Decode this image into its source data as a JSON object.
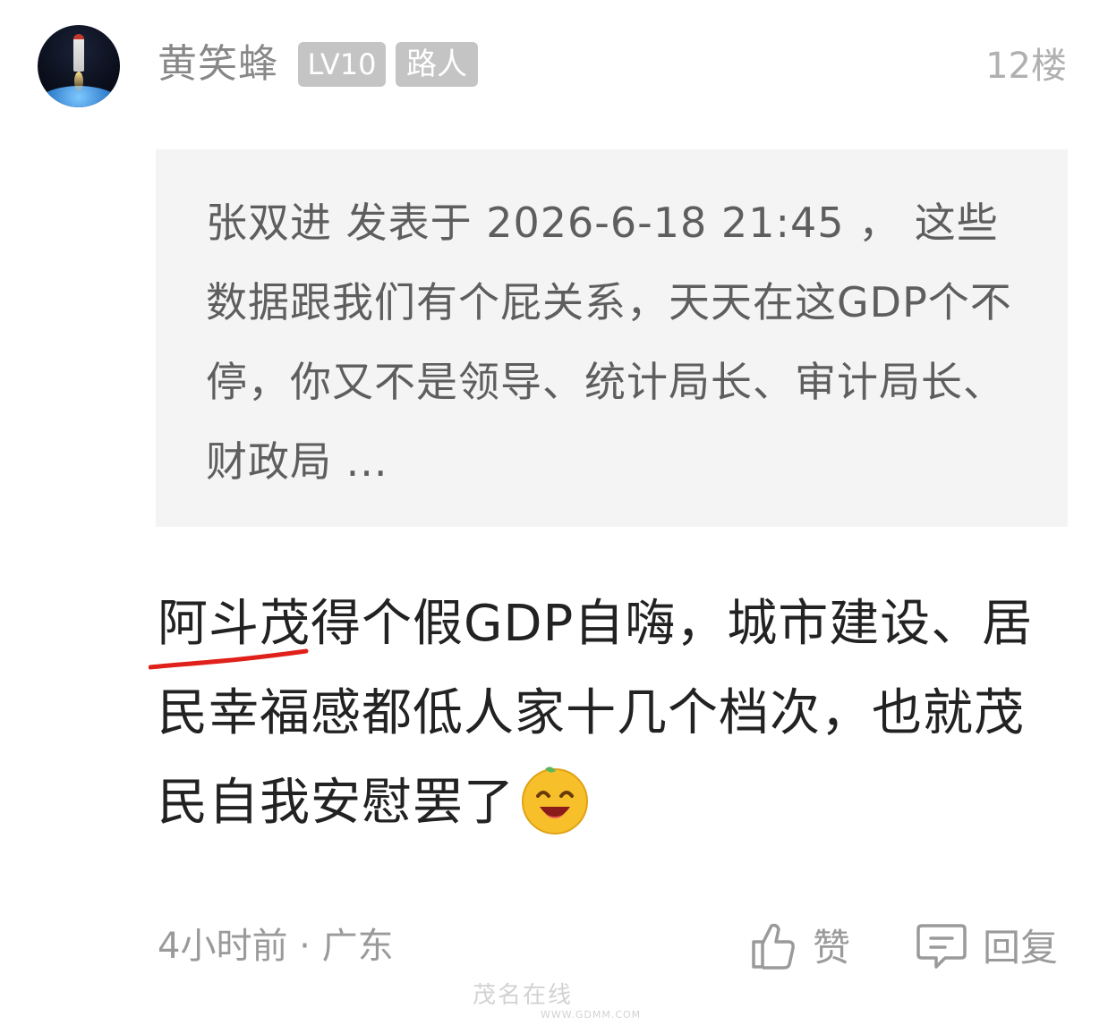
{
  "comment": {
    "author": {
      "name": "黄笑蜂",
      "level_badge": "LV10",
      "role_badge": "路人",
      "avatar_icon": "rocket-earth-avatar"
    },
    "floor": "12楼",
    "quote": {
      "text": "张双进 发表于 2026-6-18 21:45 ， 这些数据跟我们有个屁关系，天天在这GDP个不停，你又不是领导、统计局长、审计局长、财政局 ..."
    },
    "body": {
      "text": "阿斗茂得个假GDP自嗨，城市建设、居民幸福感都低人家十几个档次，也就茂民自我安慰罢了",
      "emoji_icon": "grinning-orange-emoji",
      "underline_color": "#e0201a"
    },
    "meta": "4小时前 · 广东",
    "actions": {
      "like_label": "赞",
      "reply_label": "回复"
    }
  },
  "watermark": {
    "text": "茂名在线",
    "sub": "WWW.GDMM.COM"
  }
}
